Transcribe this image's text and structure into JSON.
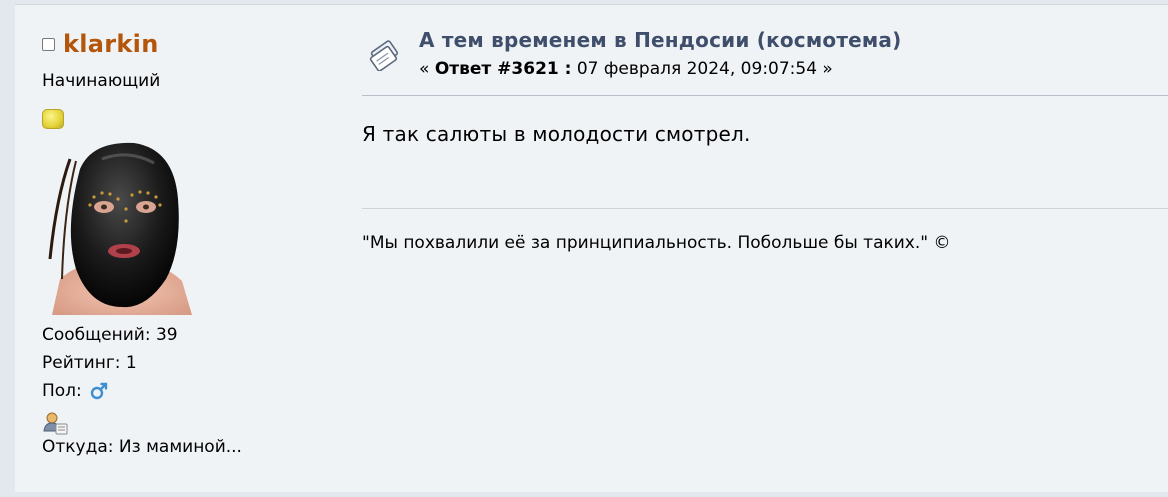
{
  "poster": {
    "name": "klarkin",
    "group": "Начинающий",
    "posts_label": "Сообщений: 39",
    "rating_label": "Рейтинг: 1",
    "gender_label": "Пол:",
    "location_label": "Откуда: Из маминой..."
  },
  "post": {
    "subject": "А тем временем в Пендосии (космотема)",
    "meta_prefix": "« ",
    "reply_label": "Ответ #3621 :",
    "date": " 07 февраля 2024, 09:07:54 »",
    "body": "Я так салюты в молодости смотрел.",
    "signature": "\"Мы похвалили её за принципиальность. Побольше бы таких.\" ©"
  },
  "colors": {
    "poster_name": "#b4550c",
    "subject": "#3f4f6b",
    "background": "#f0f3f6"
  },
  "icons": {
    "online": "offline-status-icon",
    "group_star": "rank-star-icon",
    "gender": "male-gender-icon",
    "profile": "profile-card-icon",
    "post": "post-xx-icon"
  }
}
